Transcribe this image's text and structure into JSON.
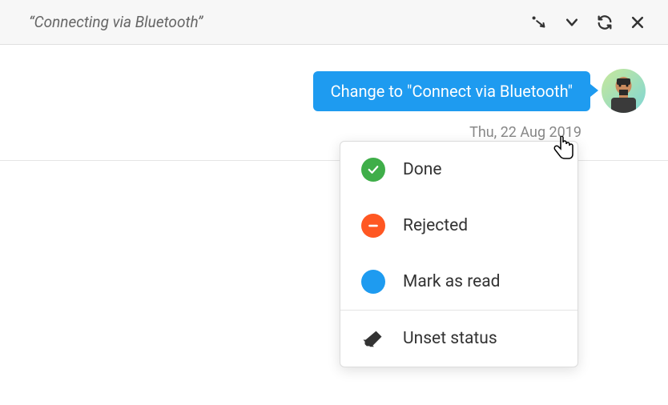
{
  "header": {
    "title": "“Connecting via Bluetooth”"
  },
  "message": {
    "text": "Change to \"Connect via Bluetooth\""
  },
  "timestamp": "Thu, 22 Aug 2019",
  "dropdown": {
    "done": "Done",
    "rejected": "Rejected",
    "mark_as_read": "Mark as read",
    "unset_status": "Unset status"
  }
}
